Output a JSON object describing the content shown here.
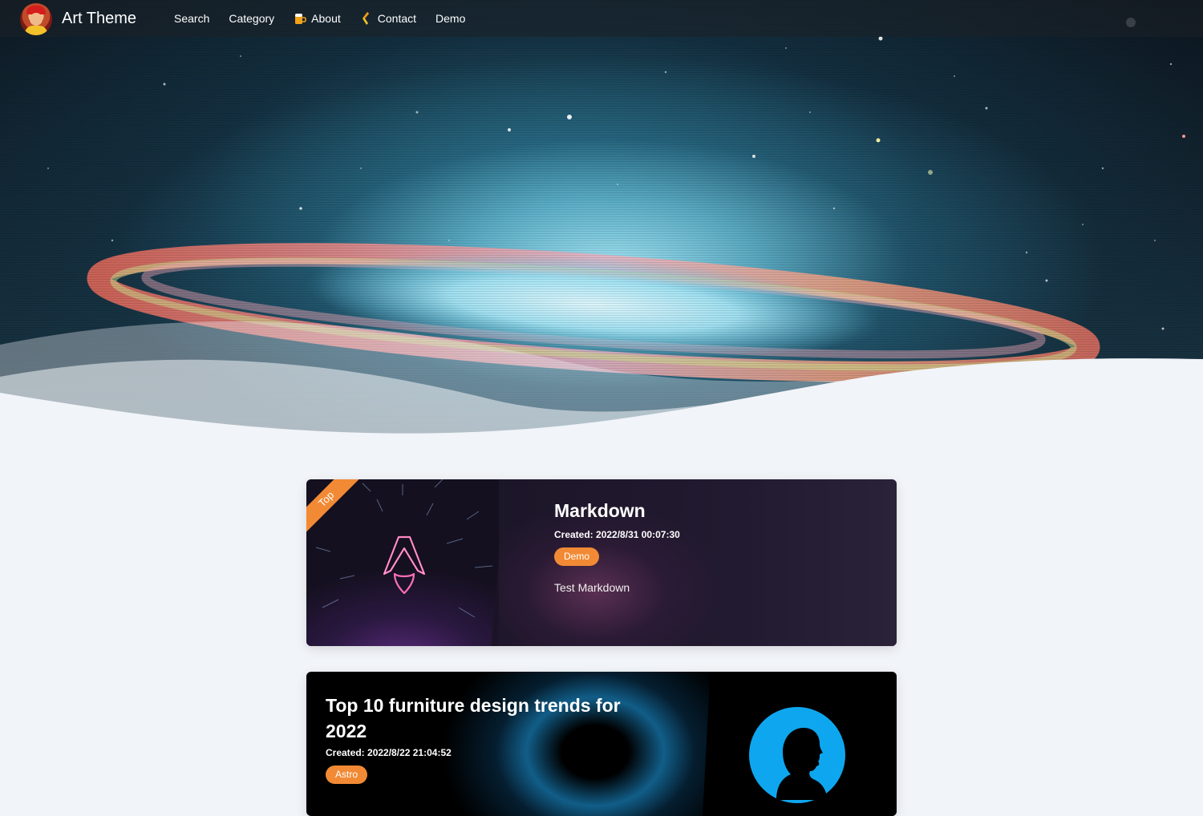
{
  "site": {
    "title": "Art Theme"
  },
  "nav": {
    "items": [
      {
        "label": "Search",
        "icon": ""
      },
      {
        "label": "Category",
        "icon": ""
      },
      {
        "label": "About",
        "icon": "beer-mug-icon"
      },
      {
        "label": "Contact",
        "icon": "flame-icon"
      },
      {
        "label": "Demo",
        "icon": ""
      }
    ]
  },
  "posts": [
    {
      "title": "Markdown",
      "created_label": "Created:",
      "created": "2022/8/31 00:07:30",
      "tag": "Demo",
      "description": "Test Markdown",
      "ribbon": "Top"
    },
    {
      "title": "Top 10 furniture design trends for 2022",
      "created_label": "Created:",
      "created": "2022/8/22 21:04:52",
      "tag": "Astro"
    }
  ],
  "colors": {
    "accent": "#f28a35",
    "page_bg": "#f1f4f8"
  }
}
